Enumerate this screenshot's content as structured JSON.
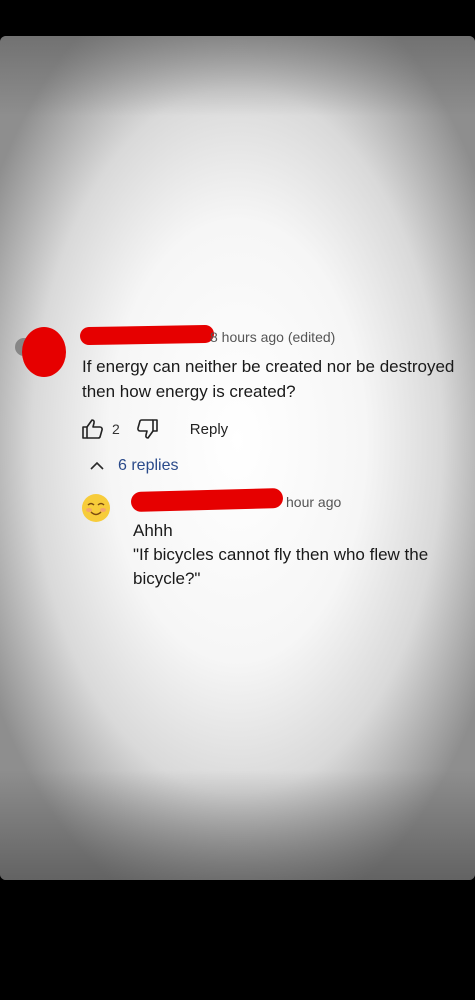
{
  "comment": {
    "time": "8 hours ago (edited)",
    "text": "If energy can neither be created nor be destroyed then how  energy is created?",
    "likes": "2",
    "reply_label": "Reply",
    "replies_toggle": "6 replies"
  },
  "reply": {
    "time": "hour ago",
    "line1": "Ahhh",
    "line2": "\"If bicycles cannot fly then who flew the bicycle?\""
  },
  "colors": {
    "redaction": "#e60000",
    "link_blue": "#2a4a8a"
  },
  "icons": {
    "like": "thumbs-up-icon",
    "dislike": "thumbs-down-icon",
    "collapse": "chevron-up-icon",
    "reply_avatar": "smiling-face-emoji"
  }
}
